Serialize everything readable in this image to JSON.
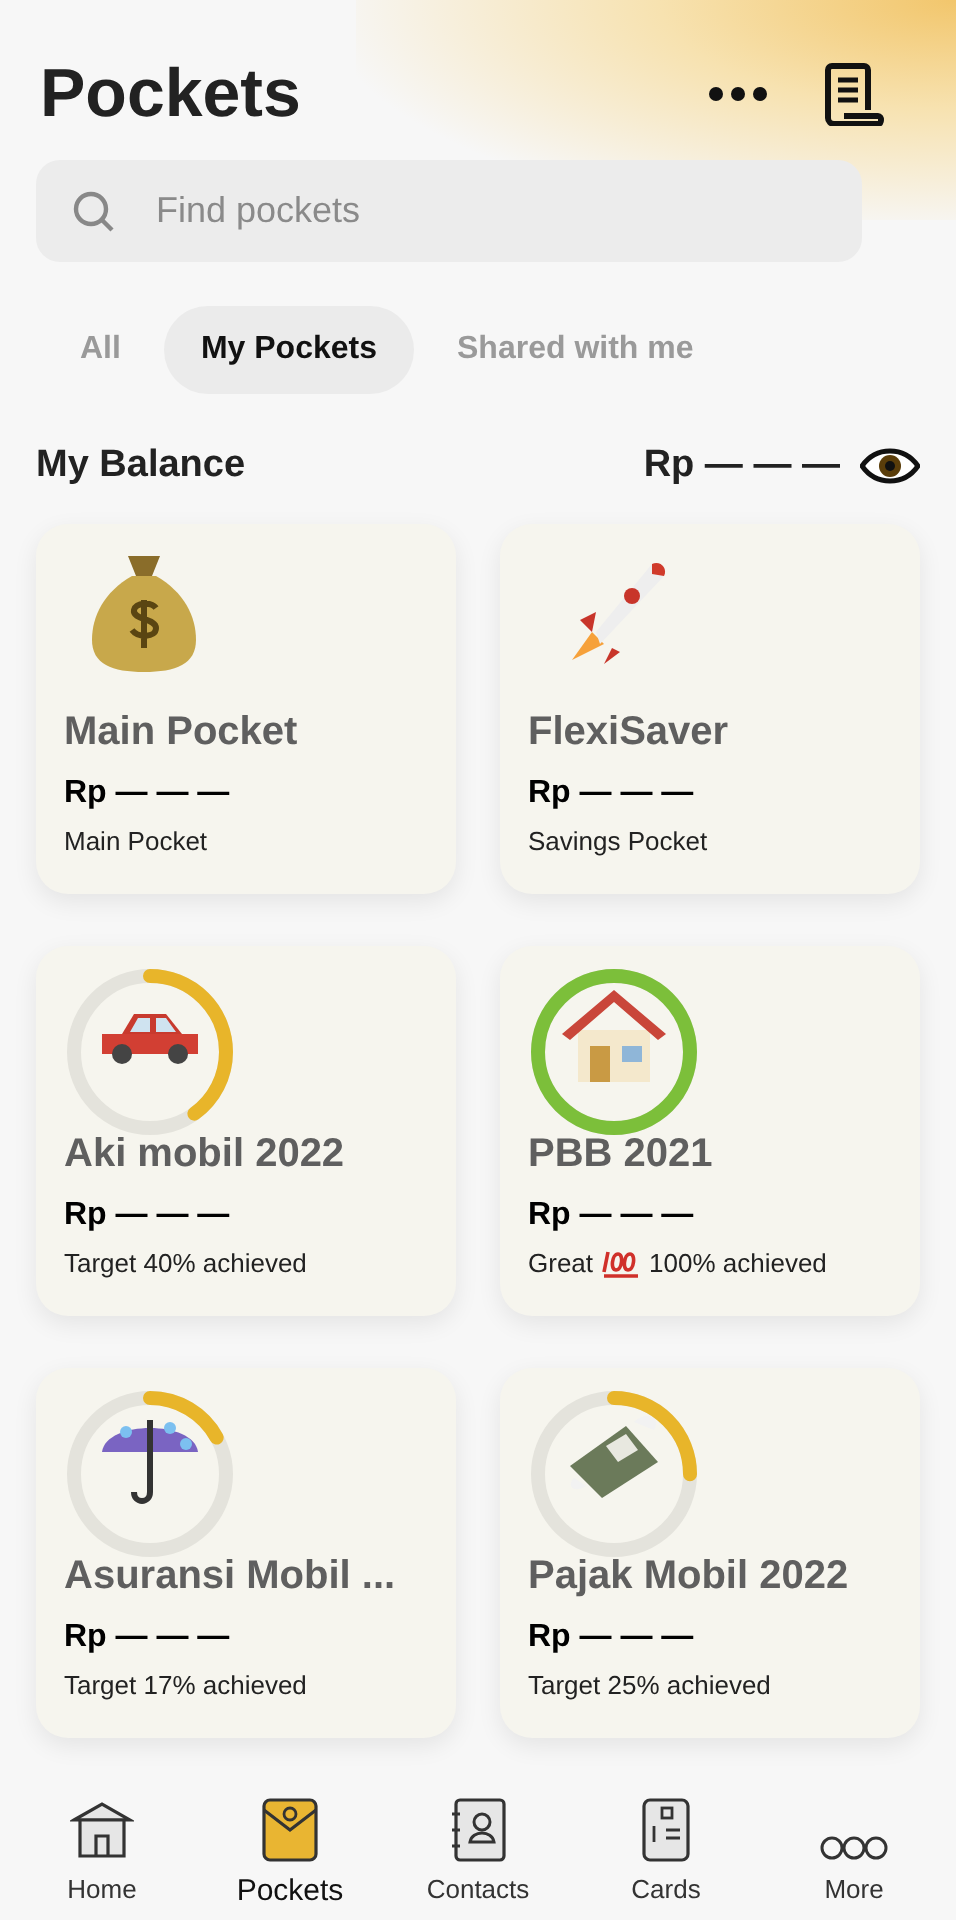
{
  "header": {
    "title": "Pockets"
  },
  "search": {
    "placeholder": "Find pockets"
  },
  "tabs": [
    {
      "label": "All",
      "selected": false
    },
    {
      "label": "My Pockets",
      "selected": true
    },
    {
      "label": "Shared with me",
      "selected": false
    }
  ],
  "balance": {
    "label": "My Balance",
    "amount": "Rp — — —"
  },
  "pockets": [
    {
      "kind": "plain",
      "name": "Main Pocket",
      "amount": "Rp — — —",
      "note": [
        "Main Pocket"
      ]
    },
    {
      "kind": "plain",
      "name": "FlexiSaver",
      "amount": "Rp — — —",
      "note": [
        "Savings Pocket"
      ]
    },
    {
      "kind": "goal",
      "level": 0.4,
      "name": "Aki mobil 2022",
      "amount": "Rp — — —",
      "note": [
        "Target 40% achieved"
      ]
    },
    {
      "kind": "goal",
      "level": 1,
      "name": "PBB 2021",
      "amount": "Rp — — —",
      "note": [
        "Great",
        "100% achieved"
      ]
    },
    {
      "kind": "goal",
      "level": 0.17,
      "name": "Asuransi Mobil ...",
      "amount": "Rp — — —",
      "note": [
        "Target 17% achieved"
      ]
    },
    {
      "kind": "goal",
      "level": 0.25,
      "name": "Pajak Mobil 2022",
      "amount": "Rp — — —",
      "note": [
        "Target 25% achieved"
      ]
    }
  ],
  "nav": [
    {
      "label": "Home",
      "selected": false
    },
    {
      "label": "Pockets",
      "selected": true
    },
    {
      "label": "Contacts",
      "selected": false
    },
    {
      "label": "Cards",
      "selected": false
    },
    {
      "label": "More",
      "selected": false
    }
  ]
}
